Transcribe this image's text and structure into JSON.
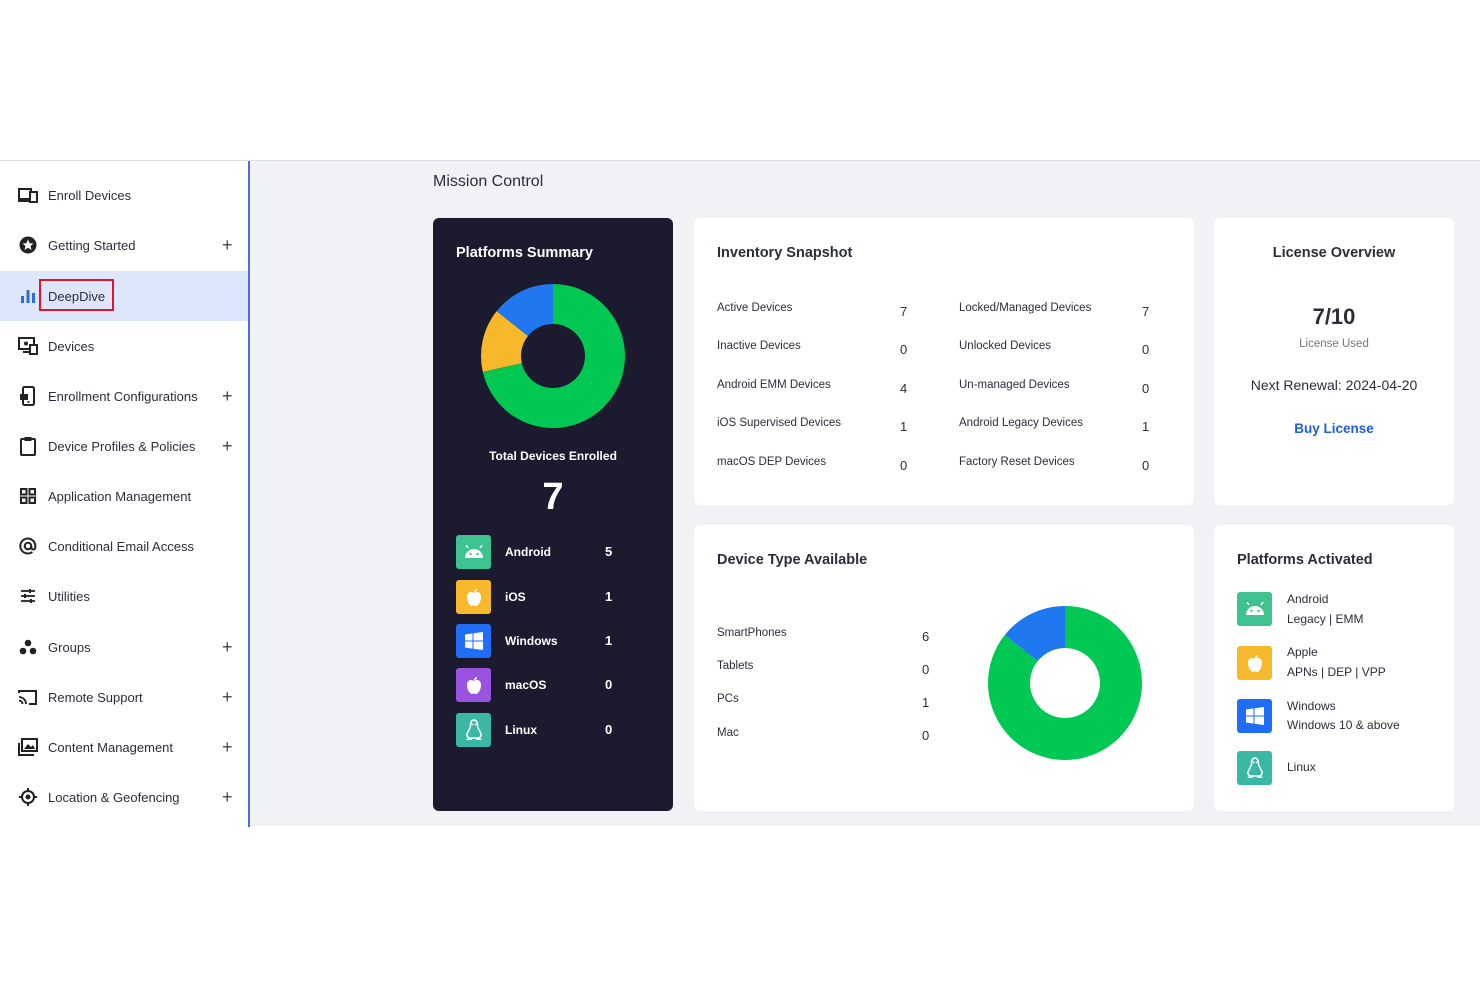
{
  "sidebar": {
    "items": [
      {
        "label": "Enroll Devices",
        "icon": "devices-icon",
        "expandable": false
      },
      {
        "label": "Getting Started",
        "icon": "star-badge-icon",
        "expandable": true
      },
      {
        "label": "DeepDive",
        "icon": "bar-chart-icon",
        "expandable": false,
        "active": true
      },
      {
        "label": "Devices",
        "icon": "monitor-icon",
        "expandable": false
      },
      {
        "label": "Enrollment Configurations",
        "icon": "phone-settings-icon",
        "expandable": true
      },
      {
        "label": "Device Profiles & Policies",
        "icon": "clipboard-icon",
        "expandable": true
      },
      {
        "label": "Application Management",
        "icon": "apps-grid-icon",
        "expandable": false
      },
      {
        "label": "Conditional Email Access",
        "icon": "at-sign-icon",
        "expandable": false
      },
      {
        "label": "Utilities",
        "icon": "sliders-icon",
        "expandable": false
      },
      {
        "label": "Groups",
        "icon": "groups-icon",
        "expandable": true
      },
      {
        "label": "Remote Support",
        "icon": "cast-icon",
        "expandable": true
      },
      {
        "label": "Content Management",
        "icon": "images-icon",
        "expandable": true
      },
      {
        "label": "Location & Geofencing",
        "icon": "location-target-icon",
        "expandable": true
      }
    ],
    "plus_symbol": "+"
  },
  "main": {
    "title": "Mission Control"
  },
  "platforms_summary": {
    "title": "Platforms Summary",
    "total_label": "Total Devices Enrolled",
    "total_value": "7",
    "platforms": [
      {
        "name": "Android",
        "value": "5",
        "color": "#3ec28f",
        "icon": "android-icon"
      },
      {
        "name": "iOS",
        "value": "1",
        "color": "#f7b82b",
        "icon": "apple-icon"
      },
      {
        "name": "Windows",
        "value": "1",
        "color": "#1f6ef5",
        "icon": "windows-icon"
      },
      {
        "name": "macOS",
        "value": "0",
        "color": "#9a52e0",
        "icon": "apple-icon"
      },
      {
        "name": "Linux",
        "value": "0",
        "color": "#3bb7a5",
        "icon": "linux-icon"
      }
    ],
    "donut": [
      {
        "label": "Android",
        "value": 5,
        "color": "#00c853"
      },
      {
        "label": "iOS",
        "value": 1,
        "color": "#f7b82b"
      },
      {
        "label": "Windows",
        "value": 1,
        "color": "#1f78f0"
      }
    ]
  },
  "inventory": {
    "title": "Inventory Snapshot",
    "left": [
      {
        "label": "Active Devices",
        "value": "7"
      },
      {
        "label": "Inactive Devices",
        "value": "0"
      },
      {
        "label": "Android EMM Devices",
        "value": "4"
      },
      {
        "label": "iOS Supervised Devices",
        "value": "1"
      },
      {
        "label": "macOS DEP Devices",
        "value": "0"
      }
    ],
    "right": [
      {
        "label": "Locked/Managed Devices",
        "value": "7"
      },
      {
        "label": "Unlocked Devices",
        "value": "0"
      },
      {
        "label": "Un-managed Devices",
        "value": "0"
      },
      {
        "label": "Android Legacy Devices",
        "value": "1"
      },
      {
        "label": "Factory Reset Devices",
        "value": "0"
      }
    ]
  },
  "license": {
    "title": "License Overview",
    "used": "7/10",
    "used_label": "License Used",
    "renewal": "Next Renewal: 2024-04-20",
    "buy_label": "Buy License",
    "link_color": "#1e5fd6"
  },
  "device_types": {
    "title": "Device Type Available",
    "items": [
      {
        "label": "SmartPhones",
        "value": "6"
      },
      {
        "label": "Tablets",
        "value": "0"
      },
      {
        "label": "PCs",
        "value": "1"
      },
      {
        "label": "Mac",
        "value": "0"
      }
    ],
    "donut": [
      {
        "label": "SmartPhones",
        "value": 6,
        "color": "#00c853"
      },
      {
        "label": "PCs",
        "value": 1,
        "color": "#1f78f0"
      }
    ]
  },
  "platforms_activated": {
    "title": "Platforms Activated",
    "items": [
      {
        "name": "Android",
        "sub": "Legacy | EMM",
        "color": "#3ec28f",
        "icon": "android-icon"
      },
      {
        "name": "Apple",
        "sub": "APNs | DEP | VPP",
        "color": "#f7b82b",
        "icon": "apple-icon"
      },
      {
        "name": "Windows",
        "sub": "Windows 10 & above",
        "color": "#1f6ef5",
        "icon": "windows-icon"
      },
      {
        "name": "Linux",
        "sub": "",
        "color": "#3bb7a5",
        "icon": "linux-icon"
      }
    ]
  }
}
